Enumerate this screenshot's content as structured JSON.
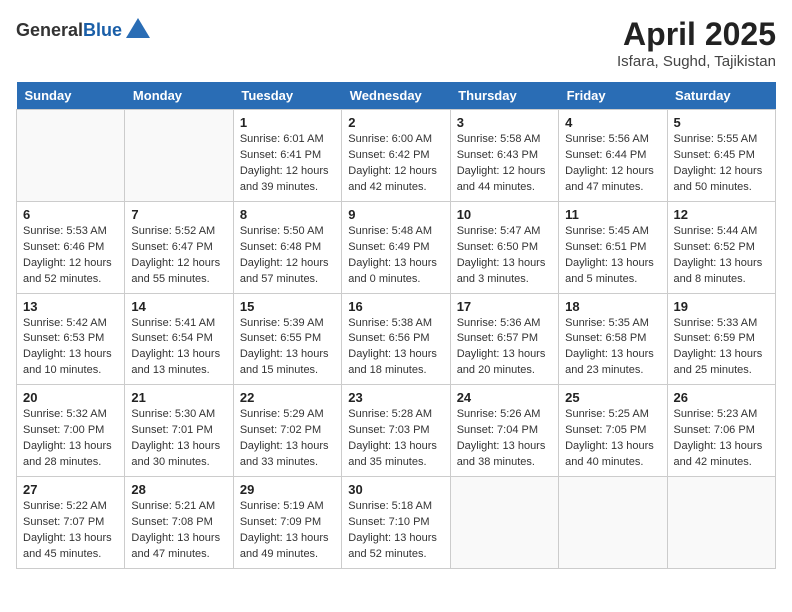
{
  "header": {
    "logo_general": "General",
    "logo_blue": "Blue",
    "title": "April 2025",
    "location": "Isfara, Sughd, Tajikistan"
  },
  "days_of_week": [
    "Sunday",
    "Monday",
    "Tuesday",
    "Wednesday",
    "Thursday",
    "Friday",
    "Saturday"
  ],
  "weeks": [
    [
      {
        "day": "",
        "info": ""
      },
      {
        "day": "",
        "info": ""
      },
      {
        "day": "1",
        "info": "Sunrise: 6:01 AM\nSunset: 6:41 PM\nDaylight: 12 hours\nand 39 minutes."
      },
      {
        "day": "2",
        "info": "Sunrise: 6:00 AM\nSunset: 6:42 PM\nDaylight: 12 hours\nand 42 minutes."
      },
      {
        "day": "3",
        "info": "Sunrise: 5:58 AM\nSunset: 6:43 PM\nDaylight: 12 hours\nand 44 minutes."
      },
      {
        "day": "4",
        "info": "Sunrise: 5:56 AM\nSunset: 6:44 PM\nDaylight: 12 hours\nand 47 minutes."
      },
      {
        "day": "5",
        "info": "Sunrise: 5:55 AM\nSunset: 6:45 PM\nDaylight: 12 hours\nand 50 minutes."
      }
    ],
    [
      {
        "day": "6",
        "info": "Sunrise: 5:53 AM\nSunset: 6:46 PM\nDaylight: 12 hours\nand 52 minutes."
      },
      {
        "day": "7",
        "info": "Sunrise: 5:52 AM\nSunset: 6:47 PM\nDaylight: 12 hours\nand 55 minutes."
      },
      {
        "day": "8",
        "info": "Sunrise: 5:50 AM\nSunset: 6:48 PM\nDaylight: 12 hours\nand 57 minutes."
      },
      {
        "day": "9",
        "info": "Sunrise: 5:48 AM\nSunset: 6:49 PM\nDaylight: 13 hours\nand 0 minutes."
      },
      {
        "day": "10",
        "info": "Sunrise: 5:47 AM\nSunset: 6:50 PM\nDaylight: 13 hours\nand 3 minutes."
      },
      {
        "day": "11",
        "info": "Sunrise: 5:45 AM\nSunset: 6:51 PM\nDaylight: 13 hours\nand 5 minutes."
      },
      {
        "day": "12",
        "info": "Sunrise: 5:44 AM\nSunset: 6:52 PM\nDaylight: 13 hours\nand 8 minutes."
      }
    ],
    [
      {
        "day": "13",
        "info": "Sunrise: 5:42 AM\nSunset: 6:53 PM\nDaylight: 13 hours\nand 10 minutes."
      },
      {
        "day": "14",
        "info": "Sunrise: 5:41 AM\nSunset: 6:54 PM\nDaylight: 13 hours\nand 13 minutes."
      },
      {
        "day": "15",
        "info": "Sunrise: 5:39 AM\nSunset: 6:55 PM\nDaylight: 13 hours\nand 15 minutes."
      },
      {
        "day": "16",
        "info": "Sunrise: 5:38 AM\nSunset: 6:56 PM\nDaylight: 13 hours\nand 18 minutes."
      },
      {
        "day": "17",
        "info": "Sunrise: 5:36 AM\nSunset: 6:57 PM\nDaylight: 13 hours\nand 20 minutes."
      },
      {
        "day": "18",
        "info": "Sunrise: 5:35 AM\nSunset: 6:58 PM\nDaylight: 13 hours\nand 23 minutes."
      },
      {
        "day": "19",
        "info": "Sunrise: 5:33 AM\nSunset: 6:59 PM\nDaylight: 13 hours\nand 25 minutes."
      }
    ],
    [
      {
        "day": "20",
        "info": "Sunrise: 5:32 AM\nSunset: 7:00 PM\nDaylight: 13 hours\nand 28 minutes."
      },
      {
        "day": "21",
        "info": "Sunrise: 5:30 AM\nSunset: 7:01 PM\nDaylight: 13 hours\nand 30 minutes."
      },
      {
        "day": "22",
        "info": "Sunrise: 5:29 AM\nSunset: 7:02 PM\nDaylight: 13 hours\nand 33 minutes."
      },
      {
        "day": "23",
        "info": "Sunrise: 5:28 AM\nSunset: 7:03 PM\nDaylight: 13 hours\nand 35 minutes."
      },
      {
        "day": "24",
        "info": "Sunrise: 5:26 AM\nSunset: 7:04 PM\nDaylight: 13 hours\nand 38 minutes."
      },
      {
        "day": "25",
        "info": "Sunrise: 5:25 AM\nSunset: 7:05 PM\nDaylight: 13 hours\nand 40 minutes."
      },
      {
        "day": "26",
        "info": "Sunrise: 5:23 AM\nSunset: 7:06 PM\nDaylight: 13 hours\nand 42 minutes."
      }
    ],
    [
      {
        "day": "27",
        "info": "Sunrise: 5:22 AM\nSunset: 7:07 PM\nDaylight: 13 hours\nand 45 minutes."
      },
      {
        "day": "28",
        "info": "Sunrise: 5:21 AM\nSunset: 7:08 PM\nDaylight: 13 hours\nand 47 minutes."
      },
      {
        "day": "29",
        "info": "Sunrise: 5:19 AM\nSunset: 7:09 PM\nDaylight: 13 hours\nand 49 minutes."
      },
      {
        "day": "30",
        "info": "Sunrise: 5:18 AM\nSunset: 7:10 PM\nDaylight: 13 hours\nand 52 minutes."
      },
      {
        "day": "",
        "info": ""
      },
      {
        "day": "",
        "info": ""
      },
      {
        "day": "",
        "info": ""
      }
    ]
  ]
}
